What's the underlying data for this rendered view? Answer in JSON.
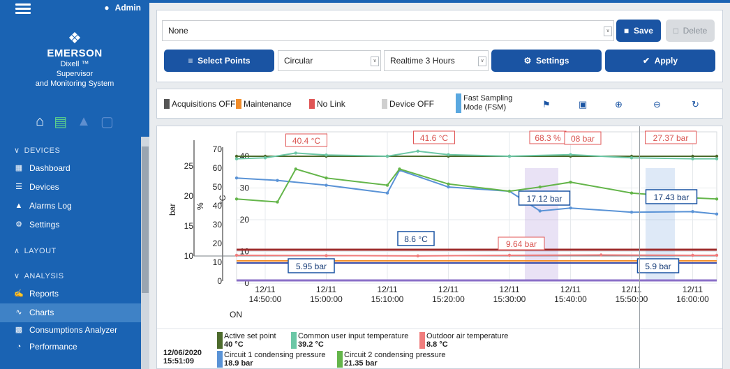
{
  "sidebar": {
    "user": "Admin",
    "logo": {
      "brand": "EMERSON",
      "product": "Dixell ™",
      "line1": "Supervisor",
      "line2": "and Monitoring System"
    },
    "sections": {
      "devices": "DEVICES",
      "layout": "LAYOUT",
      "analysis": "ANALYSIS"
    },
    "items": {
      "dashboard": "Dashboard",
      "devices": "Devices",
      "alarms": "Alarms Log",
      "settings": "Settings",
      "reports": "Reports",
      "charts": "Charts",
      "consumptions": "Consumptions Analyzer",
      "performance": "Performance"
    }
  },
  "toolbar": {
    "preset_value": "None",
    "save": "Save",
    "delete": "Delete",
    "select_points": "Select Points",
    "chart_type": "Circular",
    "time_range": "Realtime 3 Hours",
    "settings": "Settings",
    "apply": "Apply"
  },
  "legend": {
    "acq_off": "Acquisitions OFF",
    "maintenance": "Maintenance",
    "no_link": "No Link",
    "device_off": "Device OFF",
    "fsm_1": "Fast Sampling",
    "fsm_2": "Mode (FSM)",
    "colors": {
      "acq_off": "#555555",
      "maintenance": "#f28c28",
      "no_link": "#e05555",
      "device_off": "#cfcfcf",
      "fsm": "#5aa8e0"
    }
  },
  "cursor": {
    "date": "12/06/2020",
    "time": "15:51:09"
  },
  "series_legend": [
    {
      "name": "Active set point",
      "value": "40 °C",
      "color": "#4d6b2c"
    },
    {
      "name": "Common user input temperature",
      "value": "39.2 °C",
      "color": "#6cc7a6"
    },
    {
      "name": "Outdoor air temperature",
      "value": "8.8 °C",
      "color": "#f07d7d"
    },
    {
      "name": "Circuit 1 condensing pressure",
      "value": "18.9 bar",
      "color": "#5a93d6"
    },
    {
      "name": "Circuit 2 condensing pressure",
      "value": "21.35 bar",
      "color": "#64b54a"
    }
  ],
  "chart_data": {
    "type": "line",
    "axes": {
      "bar": {
        "label": "bar",
        "ticks": [
          10,
          15,
          20,
          25
        ]
      },
      "percent": {
        "label": "%",
        "ticks": [
          0,
          10,
          20,
          30,
          40,
          50,
          60,
          70
        ]
      },
      "celsius": {
        "label": "°C",
        "ticks": [
          0,
          10,
          20,
          30,
          40
        ]
      }
    },
    "x_ticks": [
      [
        "12/11",
        "14:50:00"
      ],
      [
        "12/11",
        "15:00:00"
      ],
      [
        "12/11",
        "15:10:00"
      ],
      [
        "12/11",
        "15:20:00"
      ],
      [
        "12/11",
        "15:30:00"
      ],
      [
        "12/11",
        "15:40:00"
      ],
      [
        "12/11",
        "15:50:00"
      ],
      [
        "12/11",
        "16:00:00"
      ]
    ],
    "on_label": "ON",
    "callouts_red": [
      "40.4 °C",
      "41.6 °C",
      "68.3 %",
      "08 bar",
      "27.37 bar",
      "9.64 bar"
    ],
    "callouts_blue": [
      "17.12 bar",
      "17.43 bar",
      "8.6 °C",
      "5.95 bar",
      "5.9 bar"
    ],
    "series": [
      {
        "name": "Active set point",
        "unit": "°C",
        "color": "#4d6b2c",
        "x": [
          "14:45",
          "14:50",
          "15:00",
          "15:10",
          "15:20",
          "15:30",
          "15:40",
          "15:50",
          "16:00",
          "16:05"
        ],
        "values": [
          40,
          40,
          40,
          40,
          40,
          40,
          40,
          40,
          40,
          40
        ]
      },
      {
        "name": "Common user input temperature",
        "unit": "°C",
        "color": "#6cc7a6",
        "x": [
          "14:45",
          "14:50",
          "14:55",
          "15:00",
          "15:10",
          "15:15",
          "15:20",
          "15:30",
          "15:40",
          "15:50",
          "16:00",
          "16:05"
        ],
        "values": [
          39.2,
          39.5,
          41,
          40.4,
          40,
          41.6,
          40.5,
          40,
          40.5,
          39.5,
          39.2,
          39.2
        ]
      },
      {
        "name": "Outdoor air temperature",
        "unit": "°C",
        "color": "#f07d7d",
        "x": [
          "14:45",
          "15:00",
          "15:15",
          "15:30",
          "15:45",
          "16:00",
          "16:05"
        ],
        "values": [
          8.8,
          8.7,
          8.6,
          8.8,
          8.9,
          8.8,
          8.8
        ]
      },
      {
        "name": "Circuit 1 condensing pressure",
        "unit": "bar",
        "color": "#5a93d6",
        "x": [
          "14:45",
          "14:52",
          "15:00",
          "15:10",
          "15:12",
          "15:20",
          "15:30",
          "15:35",
          "15:40",
          "15:50",
          "16:00",
          "16:05"
        ],
        "values": [
          23,
          22.6,
          21.8,
          20.5,
          24.3,
          21.5,
          20.8,
          17.5,
          18,
          17.3,
          17.4,
          17
        ]
      },
      {
        "name": "Circuit 2 condensing pressure",
        "unit": "bar",
        "color": "#64b54a",
        "x": [
          "14:45",
          "14:52",
          "14:55",
          "15:00",
          "15:10",
          "15:12",
          "15:20",
          "15:30",
          "15:35",
          "15:40",
          "15:50",
          "16:00",
          "16:05"
        ],
        "values": [
          19.5,
          19,
          24.5,
          23,
          21.8,
          24.5,
          22,
          20.8,
          21.5,
          22.3,
          20.5,
          19.7,
          19.5
        ]
      }
    ]
  }
}
